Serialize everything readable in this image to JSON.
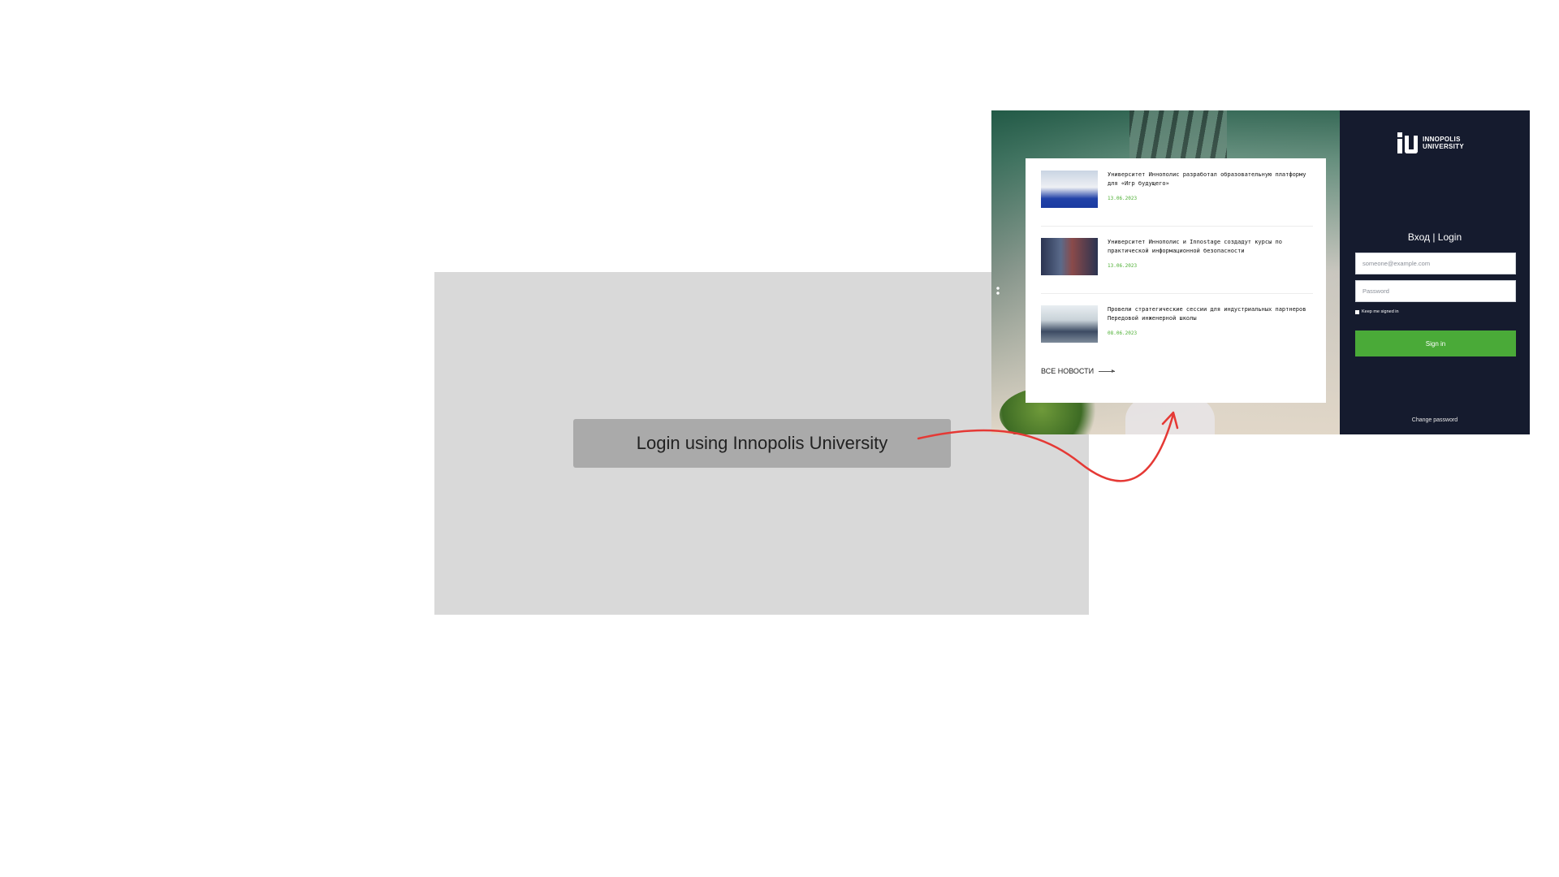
{
  "main": {
    "login_button_label": "Login using Innopolis University"
  },
  "preview": {
    "news": [
      {
        "title": "Университет Иннополис разработал образовательную платформу для «Игр будущего»",
        "date": "13.06.2023"
      },
      {
        "title": "Университет Иннополис и Innostage создадут курсы по практической информационной безопасности",
        "date": "13.06.2023"
      },
      {
        "title": "Провели стратегические сессии для индустриальных партнеров Передовой инженерной школы",
        "date": "08.06.2023"
      }
    ],
    "all_news_label": "ВСЕ НОВОСТИ",
    "logo": {
      "line1": "INNOPOLIS",
      "line2": "UNIVERSITY"
    },
    "login": {
      "heading": "Вход | Login",
      "email_placeholder": "someone@example.com",
      "password_placeholder": "Password",
      "keep_signed_in_label": "Keep me signed in",
      "sign_in_label": "Sign in",
      "change_password_label": "Change password"
    }
  },
  "colors": {
    "gray_panel": "#d9d9d9",
    "login_button_bg": "#aaaaaa",
    "arrow": "#e53935",
    "dark_sidebar": "#151b2e",
    "accent_green": "#4aaa38"
  }
}
